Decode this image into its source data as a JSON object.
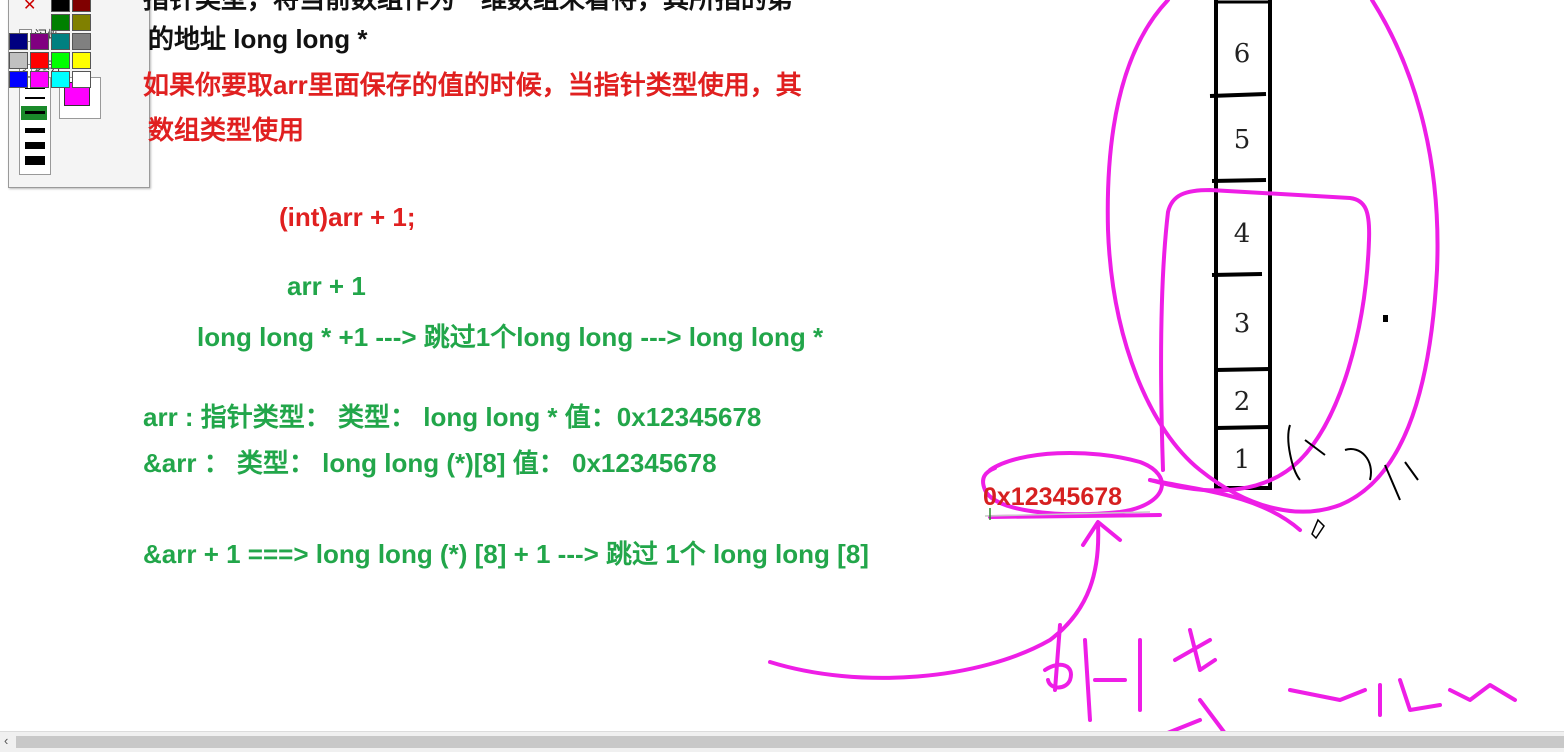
{
  "toolbar": {
    "flash_label": "闪烁",
    "transparent_label": "透明",
    "colors": {
      "current": "#ff00ff",
      "palette": [
        "#000000",
        "#800000",
        "#008000",
        "#808000",
        "#000080",
        "#800080",
        "#008080",
        "#808080",
        "#c0c0c0",
        "#ff0000",
        "#00ff00",
        "#ffff00",
        "#0000ff",
        "#ff00ff",
        "#00ffff",
        "#ffffff"
      ]
    }
  },
  "notes": {
    "line_cut": "指针类型，将当前数组作为一维数组来看待，其所指的第",
    "line1": "的地址  long long *",
    "line2": "如果你要取arr里面保存的值的时候，当指针类型使用，其",
    "line3": "数组类型使用",
    "expr_cast": "(int)arr + 1;",
    "expr_arr": "arr + 1",
    "expr_step": "long long * +1   ---> 跳过1个long long ---> long long *",
    "arr_type": "arr : 指针类型：   类型：  long long *  值：0x12345678",
    "addr_type": "&arr ：  类型：  long long (*)[8]  值：  0x12345678",
    "addr_step": "&arr  + 1 ===>  long long (*) [8]  + 1 ---> 跳过 1个 long long [8]"
  },
  "diagram": {
    "address_label": "0x12345678",
    "cells": [
      "6",
      "5",
      "4",
      "3",
      "2",
      "1"
    ],
    "ink_color": "#ee1ee6"
  }
}
